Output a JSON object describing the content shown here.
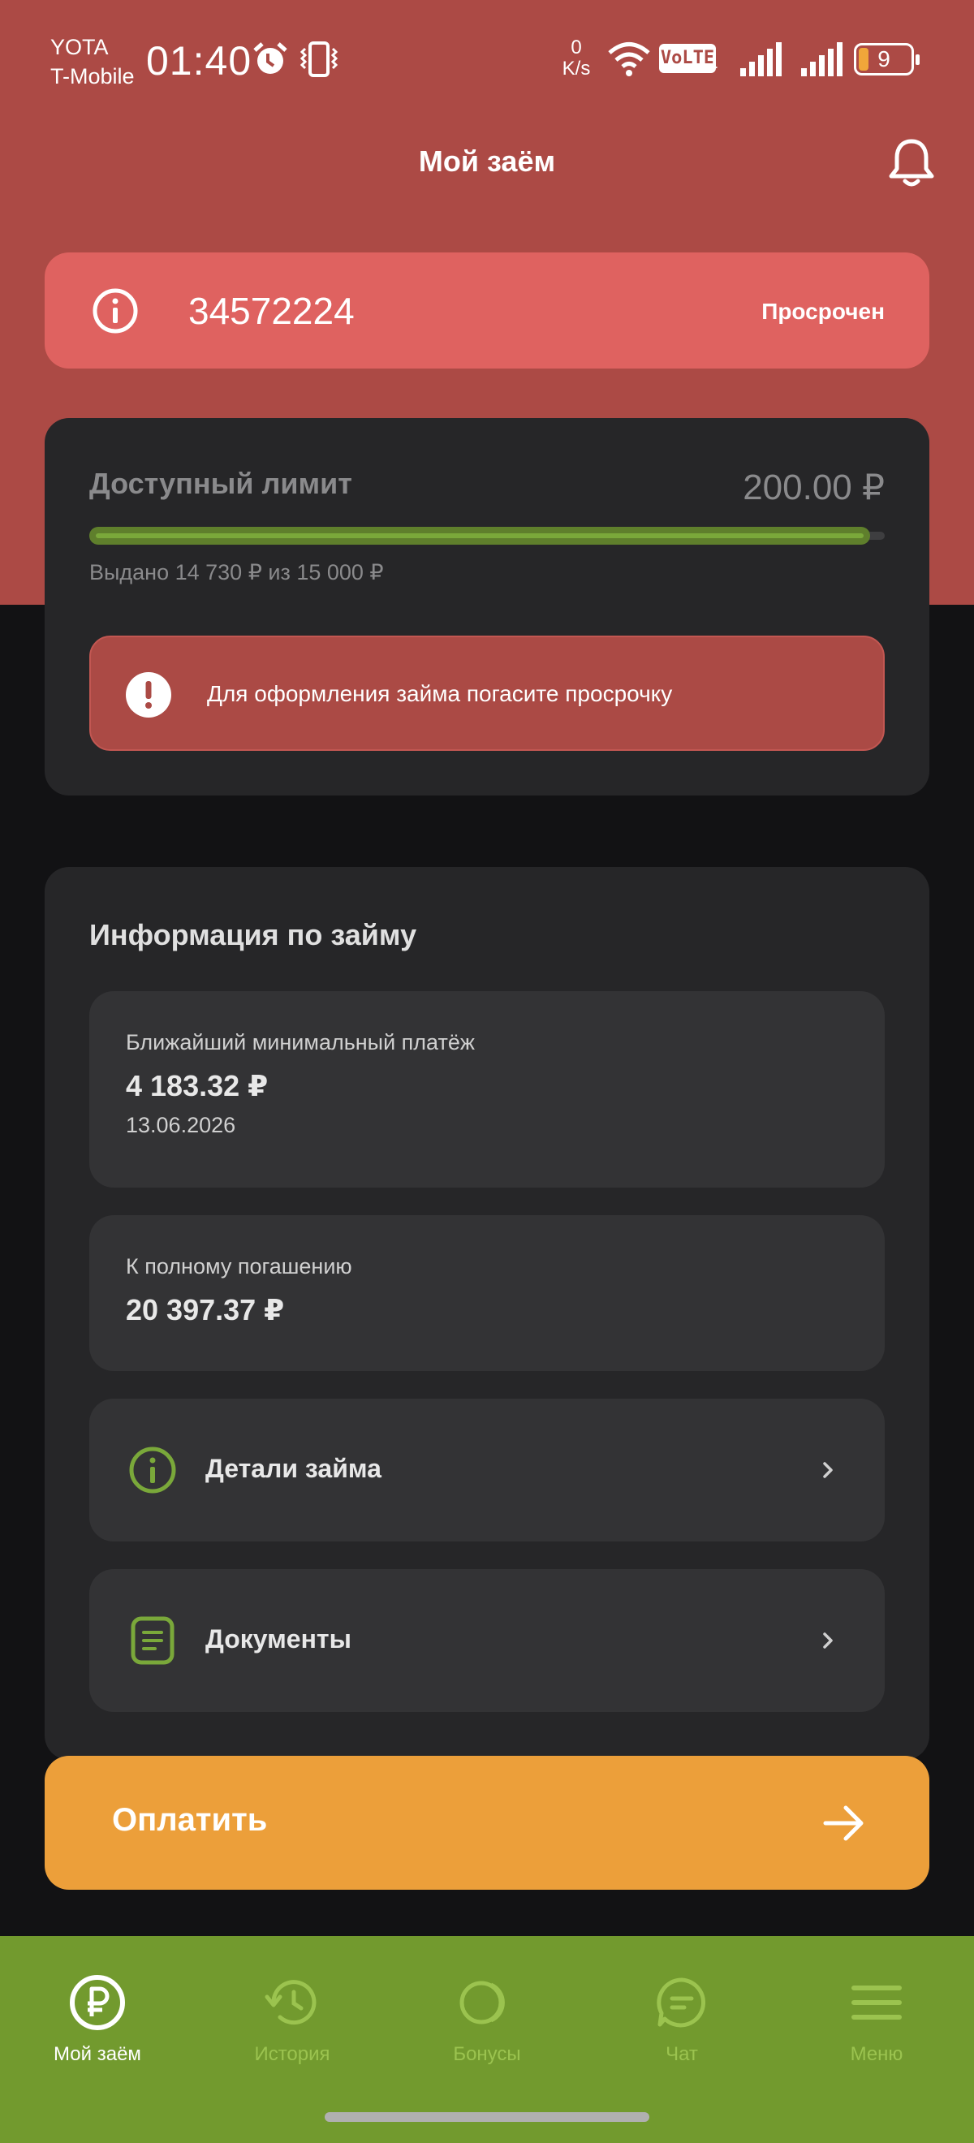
{
  "status_bar": {
    "carrier_line1": "YOTA",
    "carrier_line2": "T-Mobile",
    "time": "01:40",
    "net_speed_value": "0",
    "net_speed_unit": "K/s",
    "volte_label": "VoLTE",
    "volte_sim": "1",
    "battery_level": "9",
    "icons": [
      "alarm-icon",
      "vibrate-icon",
      "wifi-icon",
      "signal-icon",
      "battery-icon"
    ]
  },
  "header": {
    "title": "Мой заём",
    "bell_icon": "bell-icon"
  },
  "loan_banner": {
    "number": "34572224",
    "status": "Просрочен",
    "color": "#df6260"
  },
  "limit_card": {
    "label": "Доступный лимит",
    "amount": "200.00 ₽",
    "issued_text": "Выдано 14 730 ₽ из 15 000 ₽",
    "progress_fraction": 0.982,
    "warning_text": "Для оформления займа погасите просрочку"
  },
  "info_card": {
    "title": "Информация по займу",
    "next_payment": {
      "label": "Ближайший минимальный платёж",
      "amount": "4 183.32 ₽",
      "date": "13.06.2026"
    },
    "full_repayment": {
      "label": "К полному погашению",
      "amount": "20 397.37 ₽"
    },
    "rows": [
      {
        "label": "Детали займа",
        "icon": "info-icon"
      },
      {
        "label": "Документы",
        "icon": "document-icon"
      }
    ]
  },
  "pay_button": {
    "label": "Оплатить",
    "color": "#ec9f3a"
  },
  "bottom_nav": {
    "color": "#729a2e",
    "items": [
      {
        "label": "Мой заём",
        "icon": "ruble-icon",
        "active": true
      },
      {
        "label": "История",
        "icon": "history-icon",
        "active": false
      },
      {
        "label": "Бонусы",
        "icon": "bonus-icon",
        "active": false
      },
      {
        "label": "Чат",
        "icon": "chat-icon",
        "active": false
      },
      {
        "label": "Меню",
        "icon": "menu-icon",
        "active": false
      }
    ]
  }
}
